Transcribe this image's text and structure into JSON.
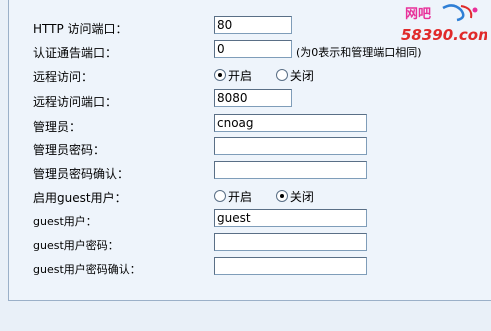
{
  "form": {
    "http_port": {
      "label": "HTTP 访问端口：",
      "value": "80"
    },
    "auth_port": {
      "label": "认证通告端口：",
      "value": "0",
      "hint": "(为0表示和管理端口相同)"
    },
    "remote_access": {
      "label": "远程访问：",
      "options": [
        "开启",
        "关闭"
      ],
      "selected": "开启"
    },
    "remote_port": {
      "label": "远程访问端口：",
      "value": "8080"
    },
    "admin": {
      "label": "管理员：",
      "value": "cnoag"
    },
    "admin_password": {
      "label": "管理员密码：",
      "value": ""
    },
    "admin_password_confirm": {
      "label": "管理员密码确认：",
      "value": ""
    },
    "guest_enable": {
      "label": "启用guest用户：",
      "options": [
        "开启",
        "关闭"
      ],
      "selected": "关闭"
    },
    "guest_user": {
      "label": "guest用户：",
      "value": "guest"
    },
    "guest_password": {
      "label": "guest用户密码：",
      "value": ""
    },
    "guest_password_confirm": {
      "label": "guest用户密码确认：",
      "value": ""
    }
  },
  "watermark": {
    "top": "网吧",
    "bottom": "58390.com",
    "colors": {
      "pink": "#e8309a",
      "blue": "#2f7fd6",
      "red": "#e02a2a"
    }
  }
}
